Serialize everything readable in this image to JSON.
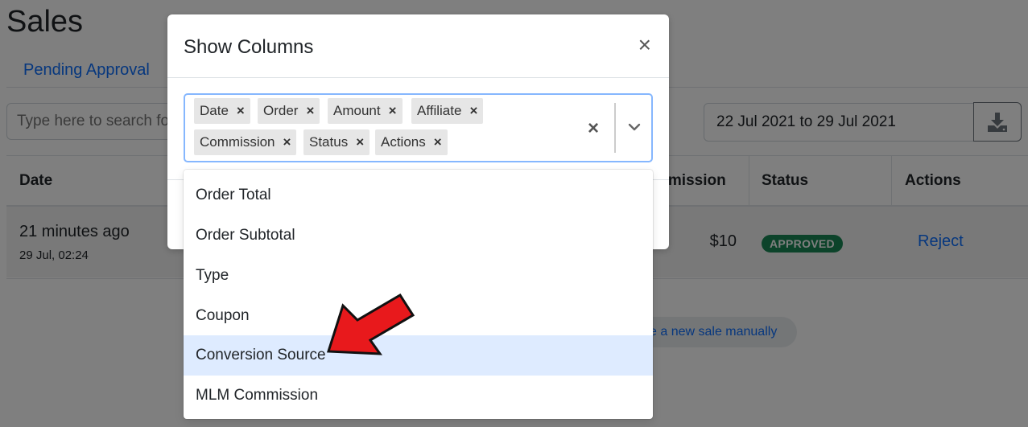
{
  "page": {
    "title": "Sales"
  },
  "tabs": [
    {
      "label": "Pending Approval"
    }
  ],
  "search": {
    "placeholder": "Type here to search fo"
  },
  "date_range": {
    "value": "22 Jul 2021 to 29 Jul 2021"
  },
  "table": {
    "headers": {
      "date": "Date",
      "commission": "mmission",
      "status": "Status",
      "actions": "Actions"
    },
    "row": {
      "time_ago": "21 minutes ago",
      "date": "29 Jul, 02:24",
      "commission": "$10",
      "status": "APPROVED",
      "action": "Reject"
    }
  },
  "manual_sale_link": {
    "label": "e a new sale manually"
  },
  "modal": {
    "title": "Show Columns",
    "close_icon": "×",
    "selected": [
      "Date",
      "Order",
      "Amount",
      "Affiliate",
      "Commission",
      "Status",
      "Actions"
    ],
    "remove_icon": "×",
    "clear_icon": "×",
    "options": [
      "Order Total",
      "Order Subtotal",
      "Type",
      "Coupon",
      "Conversion Source",
      "MLM Commission"
    ],
    "highlighted_option": "Conversion Source"
  },
  "colors": {
    "accent": "#0d6efd",
    "approved": "#198754",
    "highlight": "#deebff",
    "focus_border": "#86b7fe",
    "arrow": "#e8191c"
  }
}
